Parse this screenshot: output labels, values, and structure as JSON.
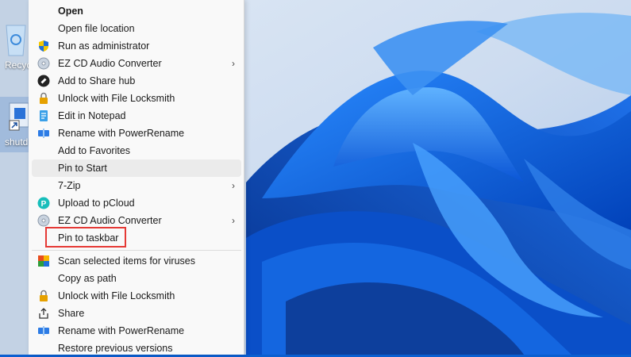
{
  "desktop": {
    "icons": [
      {
        "label": "Recycle Bin",
        "visible_label": "Recyc"
      },
      {
        "label": "shutdown",
        "visible_label": "shutd"
      }
    ]
  },
  "context_menu": {
    "items": [
      {
        "label": "Open",
        "icon": "none",
        "bold": true
      },
      {
        "label": "Open file location",
        "icon": "none"
      },
      {
        "label": "Run as administrator",
        "icon": "uac-shield-icon"
      },
      {
        "label": "EZ CD Audio Converter",
        "icon": "cd-icon",
        "submenu": true
      },
      {
        "label": "Add to Share hub",
        "icon": "share-hub-icon"
      },
      {
        "label": "Unlock with File Locksmith",
        "icon": "lock-icon"
      },
      {
        "label": "Edit in Notepad",
        "icon": "notepad-icon"
      },
      {
        "label": "Rename with PowerRename",
        "icon": "powerrename-icon"
      },
      {
        "label": "Add to Favorites",
        "icon": "none"
      },
      {
        "label": "Pin to Start",
        "icon": "none",
        "hovered": true
      },
      {
        "label": "7-Zip",
        "icon": "none",
        "submenu": true
      },
      {
        "label": "Upload to pCloud",
        "icon": "pcloud-icon"
      },
      {
        "label": "EZ CD Audio Converter",
        "icon": "cd-icon",
        "submenu": true
      },
      {
        "label": "Pin to taskbar",
        "icon": "none",
        "highlighted": true
      },
      {
        "label": "Scan selected items for viruses",
        "icon": "avast-icon"
      },
      {
        "label": "Copy as path",
        "icon": "none"
      },
      {
        "label": "Unlock with File Locksmith",
        "icon": "lock-icon"
      },
      {
        "label": "Share",
        "icon": "share-icon"
      },
      {
        "label": "Rename with PowerRename",
        "icon": "powerrename-icon"
      },
      {
        "label": "Restore previous versions",
        "icon": "none"
      }
    ],
    "submenu_glyph": "›"
  },
  "colors": {
    "highlight_border": "#e53935",
    "menu_bg": "#f9f9f9",
    "hover_bg": "#ebebeb",
    "wallpaper_blue": "#0b5fd0"
  }
}
